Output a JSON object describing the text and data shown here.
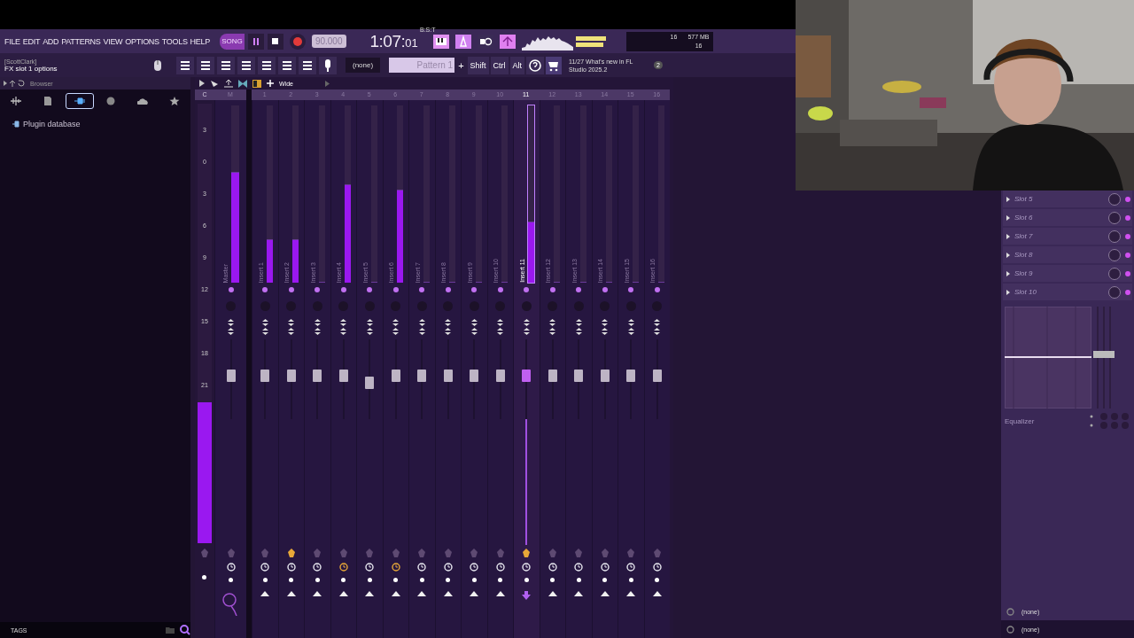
{
  "menu": [
    "FILE",
    "EDIT",
    "ADD",
    "PATTERNS",
    "VIEW",
    "OPTIONS",
    "TOOLS",
    "HELP"
  ],
  "transport": {
    "mode": "SONG",
    "playing": false,
    "tempo": "90.000",
    "time_main": "1:07:",
    "time_ticks": "01",
    "time_format": "B:S:T"
  },
  "cpu_meter": {
    "level": 0.85
  },
  "monitor": {
    "voices": "16",
    "memory": "577 MB",
    "polyphony": "16"
  },
  "hint": {
    "user": "[ScottClark]",
    "text": "FX slot 1 options"
  },
  "pattern_picker": {
    "value": "(none)"
  },
  "pattern": {
    "name": "Pattern 1",
    "add": "+"
  },
  "modifier_keys": [
    "Shift",
    "Ctrl",
    "Alt"
  ],
  "news": {
    "text": "11/27  What's new in FL Studio 2025.2",
    "badge": "2"
  },
  "browser": {
    "title": "Browser",
    "tabs": [
      {
        "kind": "waveform",
        "selected": false
      },
      {
        "kind": "file",
        "selected": false
      },
      {
        "kind": "plug",
        "selected": true
      },
      {
        "kind": "globe",
        "selected": false
      },
      {
        "kind": "cloud",
        "selected": false
      },
      {
        "kind": "star",
        "selected": false
      }
    ],
    "items": [
      {
        "label": "Plugin database"
      }
    ],
    "tags_label": "TAGS"
  },
  "mixer": {
    "view": "Wide",
    "scale_header": "C",
    "scale": [
      "3",
      "0",
      "3",
      "6",
      "9",
      "12",
      "15",
      "18",
      "21"
    ],
    "master_meter": {
      "level": 0.32
    },
    "tracks": [
      {
        "kind": "master",
        "number": "M",
        "name": "Master",
        "selected": false,
        "armed": false,
        "clock_on": false,
        "meter": {
          "level": 0.62
        },
        "fader": {
          "level": 0.55
        }
      },
      {
        "kind": "insert",
        "number": "1",
        "name": "Insert 1",
        "selected": false,
        "armed": false,
        "clock_on": false,
        "meter": {
          "level": 0.24
        },
        "fader": {
          "level": 0.55
        }
      },
      {
        "kind": "insert",
        "number": "2",
        "name": "Insert 2",
        "selected": false,
        "armed": true,
        "clock_on": false,
        "meter": {
          "level": 0.24
        },
        "fader": {
          "level": 0.55
        }
      },
      {
        "kind": "insert",
        "number": "3",
        "name": "Insert 3",
        "selected": false,
        "armed": false,
        "clock_on": false,
        "meter": {
          "level": 0
        },
        "fader": {
          "level": 0.55
        }
      },
      {
        "kind": "insert",
        "number": "4",
        "name": "Insert 4",
        "selected": false,
        "armed": false,
        "clock_on": true,
        "meter": {
          "level": 0.55
        },
        "fader": {
          "level": 0.55
        }
      },
      {
        "kind": "insert",
        "number": "5",
        "name": "Insert 5",
        "selected": false,
        "armed": false,
        "clock_on": false,
        "meter": {
          "level": 0
        },
        "fader": {
          "level": 0.45
        }
      },
      {
        "kind": "insert",
        "number": "6",
        "name": "Insert 6",
        "selected": false,
        "armed": false,
        "clock_on": true,
        "meter": {
          "level": 0.52
        },
        "fader": {
          "level": 0.55
        }
      },
      {
        "kind": "insert",
        "number": "7",
        "name": "Insert 7",
        "selected": false,
        "armed": false,
        "clock_on": false,
        "meter": {
          "level": 0
        },
        "fader": {
          "level": 0.55
        }
      },
      {
        "kind": "insert",
        "number": "8",
        "name": "Insert 8",
        "selected": false,
        "armed": false,
        "clock_on": false,
        "meter": {
          "level": 0
        },
        "fader": {
          "level": 0.55
        }
      },
      {
        "kind": "insert",
        "number": "9",
        "name": "Insert 9",
        "selected": false,
        "armed": false,
        "clock_on": false,
        "meter": {
          "level": 0
        },
        "fader": {
          "level": 0.55
        }
      },
      {
        "kind": "insert",
        "number": "10",
        "name": "Insert 10",
        "selected": false,
        "armed": false,
        "clock_on": false,
        "meter": {
          "level": 0
        },
        "fader": {
          "level": 0.55
        }
      },
      {
        "kind": "insert",
        "number": "11",
        "name": "Insert 11",
        "selected": true,
        "armed": true,
        "clock_on": false,
        "meter": {
          "level": 0.34
        },
        "fader": {
          "level": 0.55
        }
      },
      {
        "kind": "insert",
        "number": "12",
        "name": "Insert 12",
        "selected": false,
        "armed": false,
        "clock_on": false,
        "meter": {
          "level": 0
        },
        "fader": {
          "level": 0.55
        }
      },
      {
        "kind": "insert",
        "number": "13",
        "name": "Insert 13",
        "selected": false,
        "armed": false,
        "clock_on": false,
        "meter": {
          "level": 0
        },
        "fader": {
          "level": 0.55
        }
      },
      {
        "kind": "insert",
        "number": "14",
        "name": "Insert 14",
        "selected": false,
        "armed": false,
        "clock_on": false,
        "meter": {
          "level": 0
        },
        "fader": {
          "level": 0.55
        }
      },
      {
        "kind": "insert",
        "number": "15",
        "name": "Insert 15",
        "selected": false,
        "armed": false,
        "clock_on": false,
        "meter": {
          "level": 0
        },
        "fader": {
          "level": 0.55
        }
      },
      {
        "kind": "insert",
        "number": "16",
        "name": "Insert 16",
        "selected": false,
        "armed": false,
        "clock_on": false,
        "meter": {
          "level": 0
        },
        "fader": {
          "level": 0.55
        }
      }
    ]
  },
  "fx_panel": {
    "slots": [
      {
        "label": "Slot 5"
      },
      {
        "label": "Slot 6"
      },
      {
        "label": "Slot 7"
      },
      {
        "label": "Slot 8"
      },
      {
        "label": "Slot 9"
      },
      {
        "label": "Slot 10"
      }
    ],
    "eq_label": "Equalizer",
    "routing": [
      "(none)",
      "(none)"
    ]
  }
}
